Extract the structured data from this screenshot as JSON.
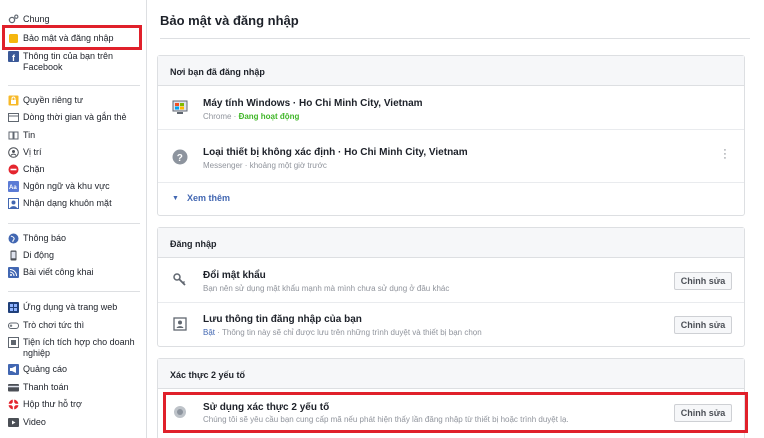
{
  "sidebar": {
    "items": [
      {
        "label": "Chung",
        "icon": "gear-icon"
      },
      {
        "label": "Bảo mật và đăng nhập",
        "icon": "shield-icon"
      },
      {
        "label": "Thông tin của bạn trên Facebook",
        "icon": "facebook-icon"
      },
      {
        "label": "Quyền riêng tư",
        "icon": "privacy-lock-icon"
      },
      {
        "label": "Dòng thời gian và gắn thẻ",
        "icon": "timeline-icon"
      },
      {
        "label": "Tin",
        "icon": "book-icon"
      },
      {
        "label": "Vị trí",
        "icon": "location-icon"
      },
      {
        "label": "Chặn",
        "icon": "block-icon"
      },
      {
        "label": "Ngôn ngữ và khu vực",
        "icon": "language-icon"
      },
      {
        "label": "Nhận dạng khuôn mặt",
        "icon": "face-recognition-icon"
      },
      {
        "label": "Thông báo",
        "icon": "globe-icon"
      },
      {
        "label": "Di động",
        "icon": "mobile-icon"
      },
      {
        "label": "Bài viết công khai",
        "icon": "rss-icon"
      },
      {
        "label": "Ứng dụng và trang web",
        "icon": "apps-icon"
      },
      {
        "label": "Trò chơi tức thì",
        "icon": "game-controller-icon"
      },
      {
        "label": "Tiện ích tích hợp cho doanh nghiệp",
        "icon": "business-integration-icon"
      },
      {
        "label": "Quảng cáo",
        "icon": "ads-icon"
      },
      {
        "label": "Thanh toán",
        "icon": "payment-card-icon"
      },
      {
        "label": "Hộp thư hỗ trợ",
        "icon": "support-lifebuoy-icon"
      },
      {
        "label": "Video",
        "icon": "video-icon"
      }
    ]
  },
  "main": {
    "title": "Bảo mật và đăng nhập",
    "where_logged_in": {
      "heading": "Nơi bạn đã đăng nhập",
      "sessions": [
        {
          "device": "Máy tính Windows · Ho Chi Minh City, Vietnam",
          "app": "Chrome",
          "sep": " · ",
          "status": "Đang hoạt động"
        },
        {
          "device": "Loại thiết bị không xác định · Ho Chi Minh City, Vietnam",
          "app": "Messenger",
          "sep": " · ",
          "status": "khoảng một giờ trước"
        }
      ],
      "see_more": "Xem thêm"
    },
    "login": {
      "heading": "Đăng nhập",
      "rows": [
        {
          "title": "Đổi mật khẩu",
          "subtitle": "Bạn nên sử dụng mật khẩu mạnh mà mình chưa sử dụng ở đâu khác",
          "button": "Chỉnh sửa"
        },
        {
          "title": "Lưu thông tin đăng nhập của bạn",
          "state": "Bật",
          "subtitle": " · Thông tin này sẽ chỉ được lưu trên những trình duyệt và thiết bị bạn chọn",
          "button": "Chỉnh sửa"
        }
      ]
    },
    "two_factor": {
      "heading": "Xác thực 2 yếu tố",
      "row": {
        "title": "Sử dụng xác thực 2 yếu tố",
        "subtitle": "Chúng tôi sẽ yêu cầu bạn cung cấp mã nếu phát hiện thấy lần đăng nhập từ thiết bị hoặc trình duyệt lạ.",
        "button": "Chỉnh sửa"
      }
    }
  },
  "colors": {
    "highlight": "#e0202a",
    "link": "#4267b2",
    "active_green": "#42b72a"
  }
}
